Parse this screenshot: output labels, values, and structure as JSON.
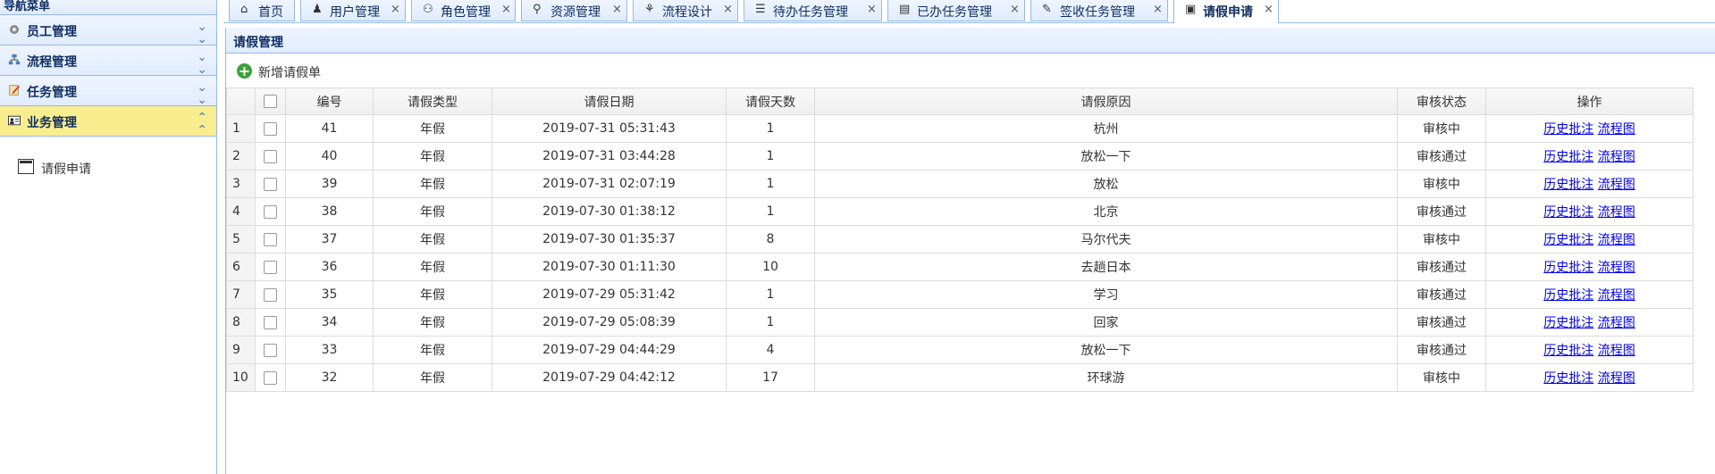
{
  "nav": {
    "title": "导航菜单",
    "sections": [
      {
        "label": "员工管理"
      },
      {
        "label": "流程管理"
      },
      {
        "label": "任务管理"
      },
      {
        "label": "业务管理"
      }
    ],
    "subitem": "请假申请"
  },
  "tabs": [
    {
      "label": "首页",
      "icon": "home-icon"
    },
    {
      "label": "用户管理",
      "icon": "users-icon"
    },
    {
      "label": "角色管理",
      "icon": "hierarchy-icon"
    },
    {
      "label": "资源管理",
      "icon": "key-icon"
    },
    {
      "label": "流程设计",
      "icon": "flow-icon"
    },
    {
      "label": "待办任务管理",
      "icon": "checklist-icon"
    },
    {
      "label": "已办任务管理",
      "icon": "done-doc-icon"
    },
    {
      "label": "签收任务管理",
      "icon": "sign-icon"
    },
    {
      "label": "请假申请",
      "icon": "calendar-icon"
    }
  ],
  "close_glyph": "×",
  "panel": {
    "title": "请假管理",
    "add_button": "新增请假单"
  },
  "table": {
    "headers": [
      "编号",
      "请假类型",
      "请假日期",
      "请假天数",
      "请假原因",
      "审核状态",
      "操作"
    ],
    "action_history": "历史批注",
    "action_flow": "流程图",
    "rows": [
      {
        "n": "1",
        "id": "41",
        "type": "年假",
        "date": "2019-07-31 05:31:43",
        "days": "1",
        "reason": "杭州",
        "status": "审核中"
      },
      {
        "n": "2",
        "id": "40",
        "type": "年假",
        "date": "2019-07-31 03:44:28",
        "days": "1",
        "reason": "放松一下",
        "status": "审核通过"
      },
      {
        "n": "3",
        "id": "39",
        "type": "年假",
        "date": "2019-07-31 02:07:19",
        "days": "1",
        "reason": "放松",
        "status": "审核中"
      },
      {
        "n": "4",
        "id": "38",
        "type": "年假",
        "date": "2019-07-30 01:38:12",
        "days": "1",
        "reason": "北京",
        "status": "审核通过"
      },
      {
        "n": "5",
        "id": "37",
        "type": "年假",
        "date": "2019-07-30 01:35:37",
        "days": "8",
        "reason": "马尔代夫",
        "status": "审核中"
      },
      {
        "n": "6",
        "id": "36",
        "type": "年假",
        "date": "2019-07-30 01:11:30",
        "days": "10",
        "reason": "去趟日本",
        "status": "审核通过"
      },
      {
        "n": "7",
        "id": "35",
        "type": "年假",
        "date": "2019-07-29 05:31:42",
        "days": "1",
        "reason": "学习",
        "status": "审核通过"
      },
      {
        "n": "8",
        "id": "34",
        "type": "年假",
        "date": "2019-07-29 05:08:39",
        "days": "1",
        "reason": "回家",
        "status": "审核通过"
      },
      {
        "n": "9",
        "id": "33",
        "type": "年假",
        "date": "2019-07-29 04:44:29",
        "days": "4",
        "reason": "放松一下",
        "status": "审核通过"
      },
      {
        "n": "10",
        "id": "32",
        "type": "年假",
        "date": "2019-07-29 04:42:12",
        "days": "17",
        "reason": "环球游",
        "status": "审核中"
      }
    ]
  },
  "colors": {
    "accent_border": "#95b8e7",
    "active_section": "#f9ee8f",
    "link": "#0000ee",
    "add_icon": "#3aa23a"
  }
}
